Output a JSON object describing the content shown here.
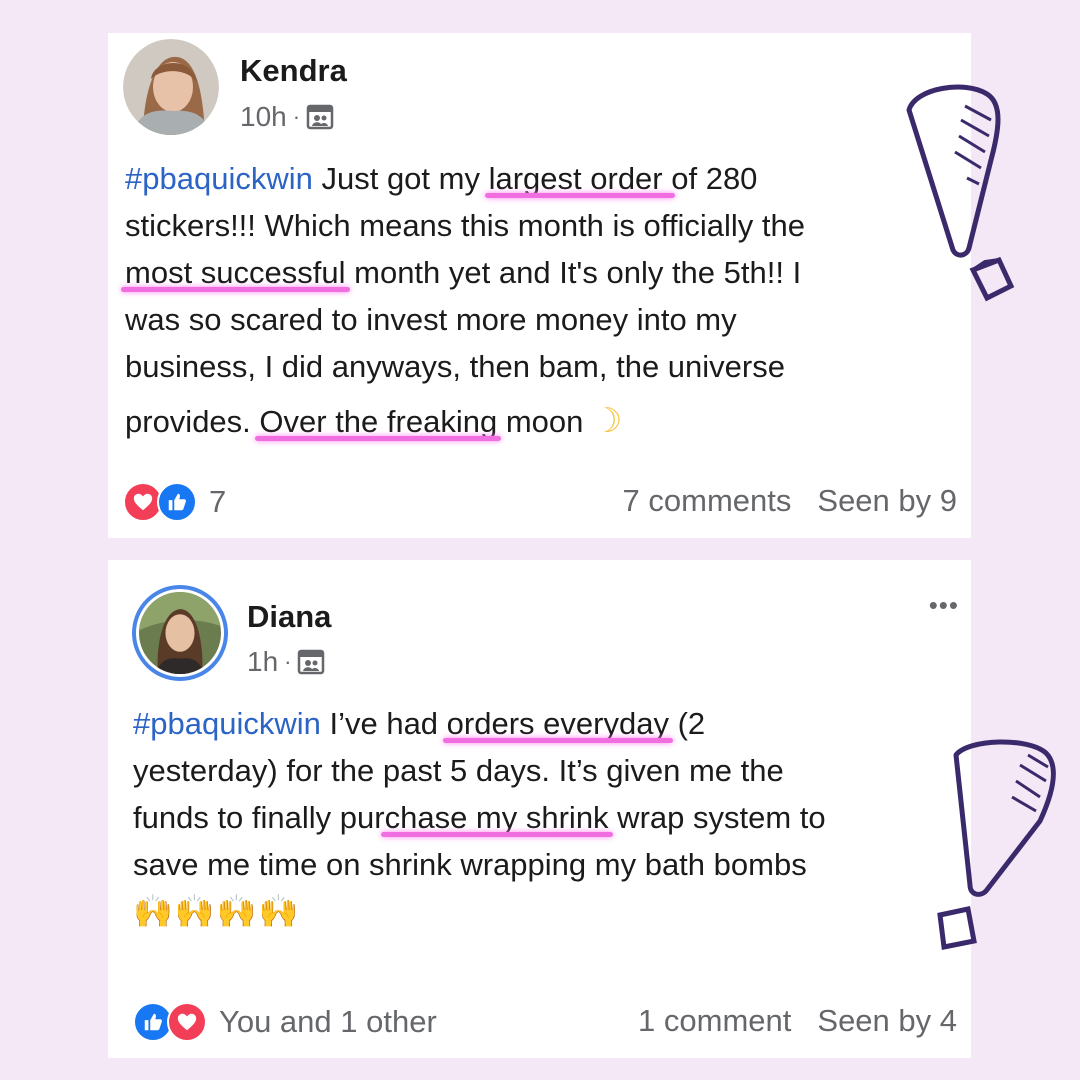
{
  "posts": [
    {
      "author": "Kendra",
      "time": "10h",
      "dot": "·",
      "lines": [
        [
          "#pbaquickwin",
          " Just got my ",
          "largest order ",
          "of 280"
        ],
        [
          "stickers!!! Which means this month is officially the"
        ],
        [
          "most successful",
          " month yet and It's only the 5th!! I"
        ],
        [
          "was so scared to invest more money into my"
        ],
        [
          "business, I did anyways, then bam, the universe"
        ],
        [
          "provides. ",
          "Over the freaking",
          " moon "
        ]
      ],
      "emoji": "☽",
      "reaction_count": "7",
      "comments": "7 comments",
      "seen_by": "Seen by 9"
    },
    {
      "author": "Diana",
      "time": "1h",
      "dot": "·",
      "more": "•••",
      "lines": [
        [
          "#pbaquickwin",
          " I’ve had ",
          "orders everyday",
          " (2"
        ],
        [
          "yesterday) for the past 5 days. It’s given me the"
        ],
        [
          "funds to finally pur",
          "chase my shrink",
          " wrap system to"
        ],
        [
          "save me time on shrink wrapping my bath bombs"
        ]
      ],
      "emoji": "🙌🙌🙌🙌",
      "reactions_label": "You and 1 other",
      "comments": "1 comment",
      "seen_by": "Seen by 4"
    }
  ],
  "colors": {
    "background": "#f5e8f6",
    "hashtag": "#2c64c6",
    "highlight": "#f06ee0",
    "like_blue": "#1877f2",
    "love_red": "#f33e58",
    "doodle": "#3b2a6b"
  },
  "icons": [
    "profile-photo-icon",
    "group-icon",
    "love-reaction-icon",
    "like-reaction-icon",
    "more-options-icon",
    "crescent-moon-icon",
    "raised-hands-icon",
    "exclamation-doodle-icon"
  ]
}
